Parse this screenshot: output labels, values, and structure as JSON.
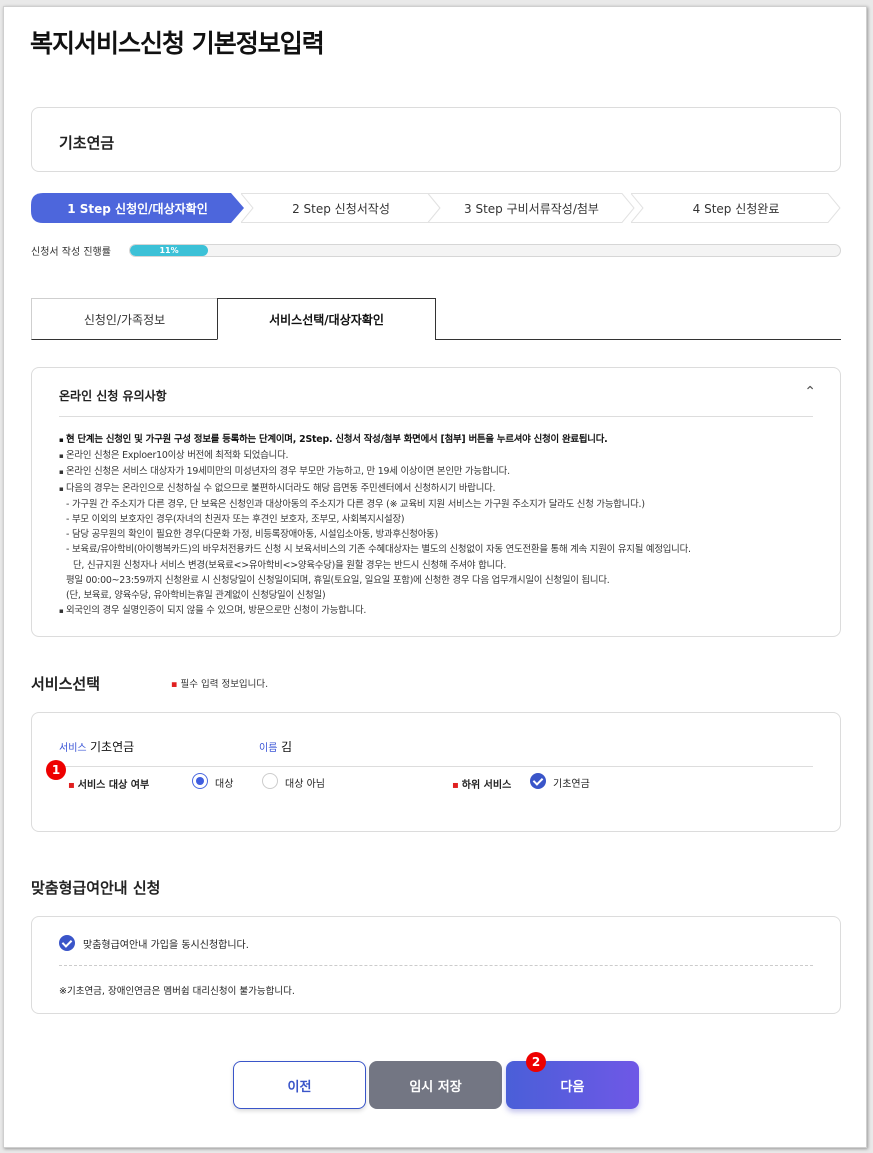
{
  "page_title": "복지서비스신청 기본정보입력",
  "service_name": "기초연금",
  "steps": [
    {
      "label": "1 Step 신청인/대상자확인",
      "active": true
    },
    {
      "label": "2 Step 신청서작성",
      "active": false
    },
    {
      "label": "3 Step 구비서류작성/첨부",
      "active": false
    },
    {
      "label": "4 Step 신청완료",
      "active": false
    }
  ],
  "progress": {
    "label": "신청서 작성 진행률",
    "value_text": "11%",
    "value": 11
  },
  "tabs": [
    {
      "label": "신청인/가족정보",
      "active": false
    },
    {
      "label": "서비스선택/대상자확인",
      "active": true
    }
  ],
  "notice": {
    "title": "온라인 신청 유의사항",
    "toggle_icon": "chevron-up-icon",
    "lines": [
      "현 단계는 신청인 및 가구원 구성 정보를 등록하는 단계이며, 2Step. 신청서 작성/첨부 화면에서 [첨부] 버튼을 누르셔야 신청이 완료됩니다.",
      "온라인 신청은 Exploer10이상 버전에 최적화 되었습니다.",
      "온라인 신청은 서비스 대상자가 19세미만의 미성년자의 경우 부모만 가능하고, 만 19세 이상이면 본인만 가능합니다.",
      "다음의 경우는 온라인으로 신청하실 수 없으므로 불편하시더라도 해당 읍면동 주민센터에서 신청하시기 바랍니다.",
      "- 가구원 간 주소지가 다른 경우, 단 보육은 신청인과 대상아동의 주소지가 다른 경우 (※ 교육비 지원 서비스는 가구원 주소지가 달라도 신청 가능합니다.)",
      "- 부모 이외의 보호자인 경우(자녀의 친권자 또는 후견인 보호자, 조부모, 사회복지시설장)",
      "- 담당 공무원의 확인이 필요한 경우(다문화 가정, 비등록장애아동, 시설입소아동, 방과후신청아동)",
      "- 보육료/유아학비(아이행복카드)의 바우처전용카드 신청 시 보육서비스의 기존 수혜대상자는 별도의 신청없이 자동 연도전환을 통해 계속 지원이 유지될 예정입니다.",
      "단, 신규지원 신청자나 서비스 변경(보육료<>유아학비<>양육수당)을 원할 경우는 반드시 신청해 주셔야 합니다.",
      "평일 00:00~23:59까지 신청완료 시 신청당일이 신청일이되며, 휴일(토요일, 일요일 포함)에 신청한 경우 다음 업무개시일이 신청일이 됩니다.",
      "(단, 보육료, 양육수당, 유아학비는휴일 관계없이 신청당일이 신청일)",
      "외국인의 경우 실명인증이 되지 않을 수 있으며, 방문으로만 신청이 가능합니다."
    ]
  },
  "service_select": {
    "title": "서비스선택",
    "required_note": "필수 입력 정보입니다.",
    "service_label": "서비스",
    "service_value": "기초연금",
    "name_label": "이름",
    "name_value": "김",
    "target_label": "서비스 대상 여부",
    "option_yes": "대상",
    "option_no": "대상 아님",
    "selected": "대상",
    "sub_service_label": "하위 서비스",
    "sub_service_value": "기초연금",
    "badge_1": "1"
  },
  "custom_benefit": {
    "title": "맞춤형급여안내 신청",
    "checkbox_label": "맞춤형급여안내 가입을 동시신청합니다.",
    "note": "※기초연금, 장애인연금은 멤버쉽 대리신청이 불가능합니다."
  },
  "buttons": {
    "prev": "이전",
    "save": "임시 저장",
    "next": "다음",
    "badge_2": "2"
  },
  "colors": {
    "accent": "#3a55c9",
    "progress": "#3cc1d7",
    "badge": "#e00000",
    "save_button": "#737683"
  }
}
